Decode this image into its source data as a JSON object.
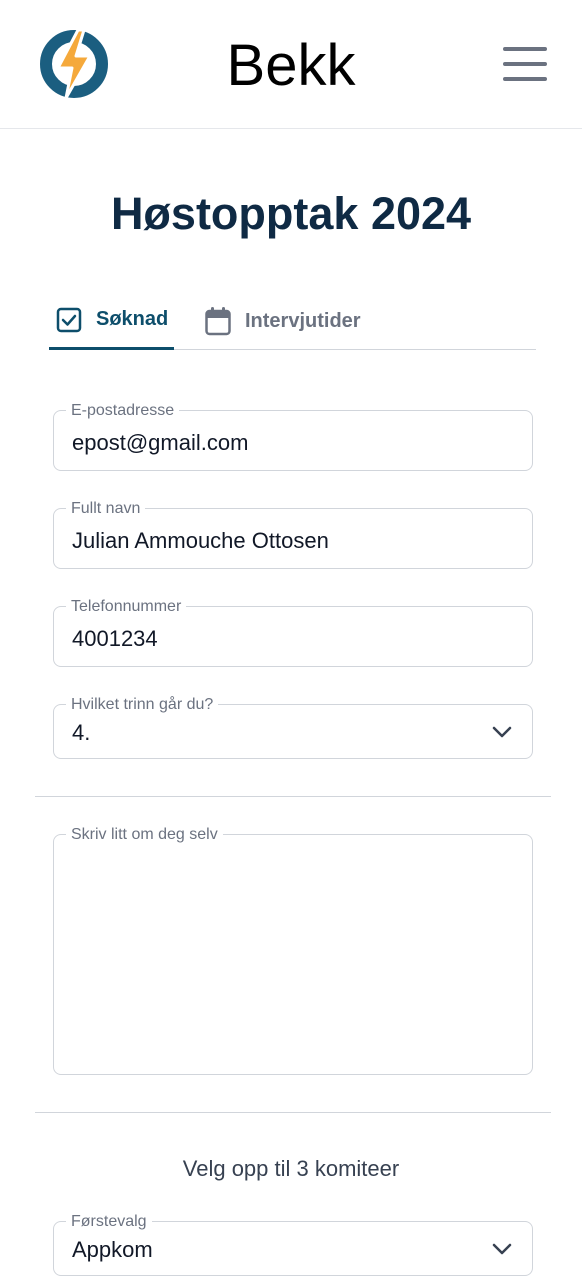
{
  "header": {
    "brand": "Bekk",
    "logo_icon": "lightning-bolt-logo",
    "menu_icon": "hamburger-menu-icon",
    "colors": {
      "logo_ring": "#1b5e80",
      "logo_bolt": "#f5a93b"
    }
  },
  "page": {
    "title": "Høstopptak 2024"
  },
  "tabs": [
    {
      "label": "Søknad",
      "icon": "checkbox-icon",
      "active": true
    },
    {
      "label": "Intervjutider",
      "icon": "calendar-icon",
      "active": false
    }
  ],
  "form": {
    "email": {
      "label": "E-postadresse",
      "value": "epost@gmail.com"
    },
    "name": {
      "label": "Fullt navn",
      "value": "Julian Ammouche Ottosen"
    },
    "phone": {
      "label": "Telefonnummer",
      "value": "4001234"
    },
    "grade": {
      "label": "Hvilket trinn går du?",
      "value": "4."
    },
    "about": {
      "label": "Skriv litt om deg selv",
      "value": ""
    },
    "committees_title": "Velg opp til 3 komiteer",
    "first_choice": {
      "label": "Førstevalg",
      "value": "Appkom"
    }
  },
  "colors": {
    "accent": "#0d4e6b",
    "title": "#0f2a44",
    "muted": "#6b7280",
    "border": "#d1d5db"
  }
}
